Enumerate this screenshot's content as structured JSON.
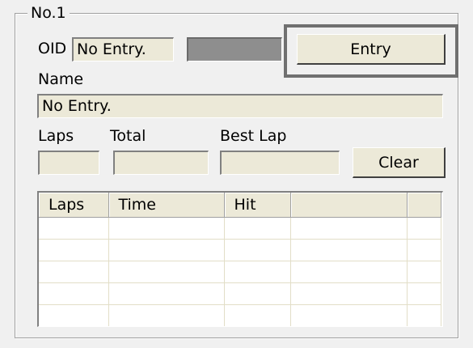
{
  "panel": {
    "title": "No.1",
    "oid_label": "OID",
    "oid_value": "No Entry.",
    "entry_button": "Entry",
    "name_label": "Name",
    "name_value": "No Entry.",
    "laps_label": "Laps",
    "total_label": "Total",
    "best_lap_label": "Best Lap",
    "laps_value": "",
    "total_value": "",
    "best_lap_value": "",
    "clear_button": "Clear"
  },
  "table": {
    "columns": [
      "Laps",
      "Time",
      "Hit",
      "",
      ""
    ],
    "rows": [
      [
        "",
        "",
        "",
        "",
        ""
      ],
      [
        "",
        "",
        "",
        "",
        ""
      ],
      [
        "",
        "",
        "",
        "",
        ""
      ],
      [
        "",
        "",
        "",
        "",
        ""
      ],
      [
        "",
        "",
        "",
        "",
        ""
      ]
    ]
  }
}
